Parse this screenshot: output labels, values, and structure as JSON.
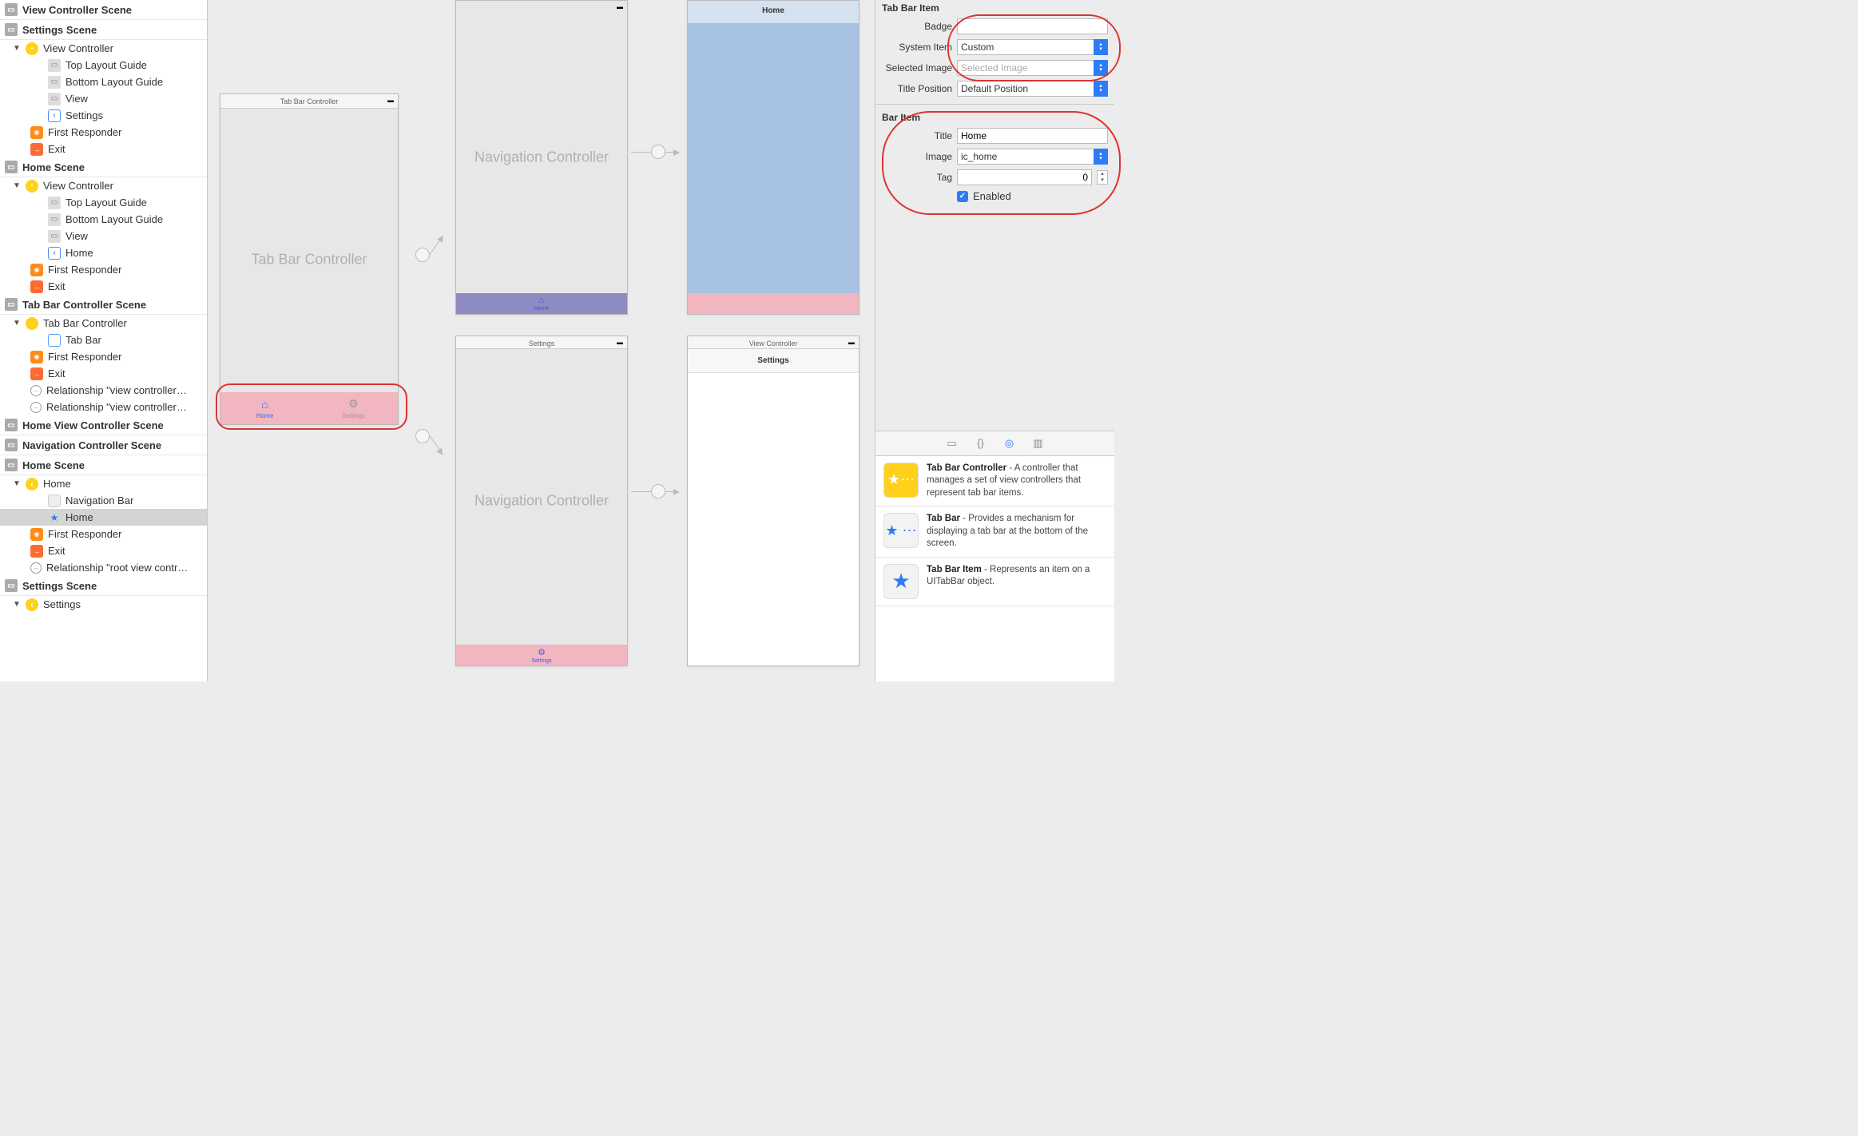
{
  "outline": {
    "groups": [
      {
        "title": "View Controller Scene",
        "items": []
      },
      {
        "title": "Settings Scene",
        "items": [
          {
            "kind": "vc",
            "label": "View Controller",
            "disclosure": "▼",
            "indent": 1
          },
          {
            "kind": "guide",
            "label": "Top Layout Guide",
            "indent": 3
          },
          {
            "kind": "guide",
            "label": "Bottom Layout Guide",
            "indent": 3
          },
          {
            "kind": "guide",
            "label": "View",
            "indent": 3
          },
          {
            "kind": "back",
            "label": "Settings",
            "indent": 3
          },
          {
            "kind": "cube",
            "label": "First Responder",
            "indent": 2
          },
          {
            "kind": "exit",
            "label": "Exit",
            "indent": 2
          }
        ]
      },
      {
        "title": "Home Scene",
        "items": [
          {
            "kind": "vc",
            "label": "View Controller",
            "disclosure": "▼",
            "indent": 1
          },
          {
            "kind": "guide",
            "label": "Top Layout Guide",
            "indent": 3
          },
          {
            "kind": "guide",
            "label": "Bottom Layout Guide",
            "indent": 3
          },
          {
            "kind": "guide",
            "label": "View",
            "indent": 3
          },
          {
            "kind": "back",
            "label": "Home",
            "indent": 3
          },
          {
            "kind": "cube",
            "label": "First Responder",
            "indent": 2
          },
          {
            "kind": "exit",
            "label": "Exit",
            "indent": 2
          }
        ]
      },
      {
        "title": "Tab Bar Controller Scene",
        "items": [
          {
            "kind": "tbc",
            "label": "Tab Bar Controller",
            "disclosure": "▼",
            "indent": 1
          },
          {
            "kind": "tabbar",
            "label": "Tab Bar",
            "indent": 3
          },
          {
            "kind": "cube",
            "label": "First Responder",
            "indent": 2
          },
          {
            "kind": "exit",
            "label": "Exit",
            "indent": 2
          },
          {
            "kind": "rel",
            "label": "Relationship \"view controller…",
            "indent": 2
          },
          {
            "kind": "rel",
            "label": "Relationship \"view controller…",
            "indent": 2
          }
        ]
      },
      {
        "title": "Home View Controller Scene",
        "items": []
      },
      {
        "title": "Navigation Controller Scene",
        "items": []
      },
      {
        "title": "Home Scene",
        "items": [
          {
            "kind": "nav",
            "label": "Home",
            "disclosure": "▼",
            "indent": 1
          },
          {
            "kind": "navbar",
            "label": "Navigation Bar",
            "indent": 3
          },
          {
            "kind": "star",
            "label": "Home",
            "indent": 3,
            "selected": true
          },
          {
            "kind": "cube",
            "label": "First Responder",
            "indent": 2
          },
          {
            "kind": "exit",
            "label": "Exit",
            "indent": 2
          },
          {
            "kind": "rel",
            "label": "Relationship \"root view contr…",
            "indent": 2
          }
        ]
      },
      {
        "title": "Settings Scene",
        "items": [
          {
            "kind": "nav",
            "label": "Settings",
            "disclosure": "▼",
            "indent": 1,
            "cut": true
          }
        ]
      }
    ]
  },
  "canvas": {
    "tabbarvc_title": "Tab Bar Controller",
    "tabbarvc_center": "Tab Bar Controller",
    "tab_home": "Home",
    "tab_settings": "Settings",
    "nav1_title": "Navigation Controller",
    "nav1_tab": "Home",
    "nav2_center": "Navigation Controller",
    "nav2_title": "Settings",
    "nav2_tab": "Settings",
    "homevc_navtitle": "Home",
    "settingsvc_title": "View Controller",
    "settingsvc_navtitle": "Settings"
  },
  "inspector": {
    "section1": "Tab Bar Item",
    "badge_label": "Badge",
    "badge_val": "",
    "sysitem_label": "System Item",
    "sysitem_val": "Custom",
    "selimg_label": "Selected Image",
    "selimg_placeholder": "Selected Image",
    "titlepos_label": "Title Position",
    "titlepos_val": "Default Position",
    "section2": "Bar Item",
    "title_label": "Title",
    "title_val": "Home",
    "image_label": "Image",
    "image_val": "ic_home",
    "tag_label": "Tag",
    "tag_val": "0",
    "enabled_label": "Enabled",
    "library": [
      {
        "name": "Tab Bar Controller",
        "desc": " - A controller that manages a set of view controllers that represent tab bar items.",
        "thumb": "yellow",
        "glyph": "★⋯"
      },
      {
        "name": "Tab Bar",
        "desc": " - Provides a mechanism for displaying a tab bar at the bottom of the screen.",
        "thumb": "plain",
        "glyph": "★⋯"
      },
      {
        "name": "Tab Bar Item",
        "desc": " - Represents an item on a UITabBar object.",
        "thumb": "plain",
        "glyph": "★"
      }
    ]
  }
}
